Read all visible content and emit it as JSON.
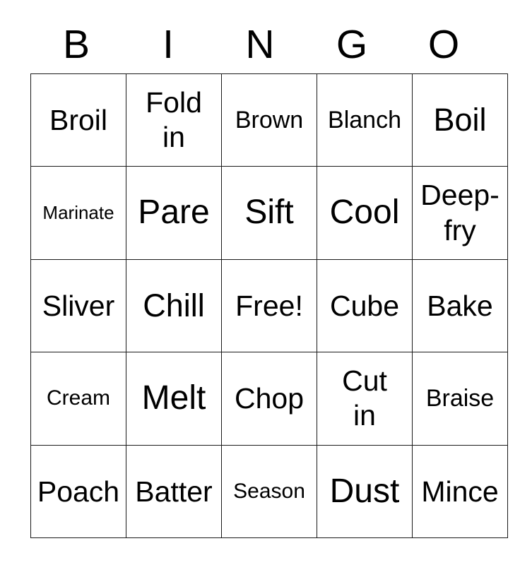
{
  "card": {
    "title": "BINGO",
    "header_letters": [
      "B",
      "I",
      "N",
      "G",
      "O"
    ],
    "free_space_label": "Free!",
    "free_space_position": {
      "row": 2,
      "col": 2
    },
    "grid_size": "5x5",
    "colors": {
      "background": "#ffffff",
      "text": "#000000",
      "border": "#1a1a1a"
    },
    "rows": [
      [
        {
          "label": "Broil",
          "size": "md",
          "lines": [
            "Broil"
          ]
        },
        {
          "label": "Fold in",
          "size": "md",
          "lines": [
            "Fold",
            "in"
          ]
        },
        {
          "label": "Brown",
          "size": "sm",
          "lines": [
            "Brown"
          ]
        },
        {
          "label": "Blanch",
          "size": "sm",
          "lines": [
            "Blanch"
          ]
        },
        {
          "label": "Boil",
          "size": "lg",
          "lines": [
            "Boil"
          ]
        }
      ],
      [
        {
          "label": "Marinate",
          "size": "xxs",
          "lines": [
            "Marinate"
          ]
        },
        {
          "label": "Pare",
          "size": "xl",
          "lines": [
            "Pare"
          ]
        },
        {
          "label": "Sift",
          "size": "xl",
          "lines": [
            "Sift"
          ]
        },
        {
          "label": "Cool",
          "size": "xl",
          "lines": [
            "Cool"
          ]
        },
        {
          "label": "Deep-fry",
          "size": "md",
          "lines": [
            "Deep-",
            "fry"
          ]
        }
      ],
      [
        {
          "label": "Sliver",
          "size": "md",
          "lines": [
            "Sliver"
          ]
        },
        {
          "label": "Chill",
          "size": "lg",
          "lines": [
            "Chill"
          ]
        },
        {
          "label": "Free!",
          "size": "md",
          "lines": [
            "Free!"
          ]
        },
        {
          "label": "Cube",
          "size": "md",
          "lines": [
            "Cube"
          ]
        },
        {
          "label": "Bake",
          "size": "md",
          "lines": [
            "Bake"
          ]
        }
      ],
      [
        {
          "label": "Cream",
          "size": "xs",
          "lines": [
            "Cream"
          ]
        },
        {
          "label": "Melt",
          "size": "xl",
          "lines": [
            "Melt"
          ]
        },
        {
          "label": "Chop",
          "size": "md",
          "lines": [
            "Chop"
          ]
        },
        {
          "label": "Cut in",
          "size": "md",
          "lines": [
            "Cut",
            "in"
          ]
        },
        {
          "label": "Braise",
          "size": "sm",
          "lines": [
            "Braise"
          ]
        }
      ],
      [
        {
          "label": "Poach",
          "size": "md",
          "lines": [
            "Poach"
          ]
        },
        {
          "label": "Batter",
          "size": "md",
          "lines": [
            "Batter"
          ]
        },
        {
          "label": "Season",
          "size": "xs",
          "lines": [
            "Season"
          ]
        },
        {
          "label": "Dust",
          "size": "xl",
          "lines": [
            "Dust"
          ]
        },
        {
          "label": "Mince",
          "size": "md",
          "lines": [
            "Mince"
          ]
        }
      ]
    ]
  }
}
